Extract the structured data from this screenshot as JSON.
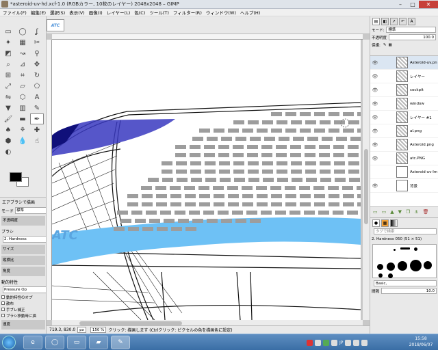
{
  "window": {
    "title": "*asteroid-uv-hd.xcf-1.0 (RGBカラー, 10枚のレイヤー) 2048x2048 – GIMP",
    "minimize": "–",
    "maximize": "□",
    "close": "✕"
  },
  "menu": [
    "ファイル(F)",
    "編集(E)",
    "選択(S)",
    "表示(V)",
    "画像(I)",
    "レイヤー(L)",
    "色(C)",
    "ツール(T)",
    "フィルター(R)",
    "ウィンドウ(W)",
    "ヘルプ(H)"
  ],
  "tools": [
    "rect-select-icon",
    "ellipse-select-icon",
    "lasso-icon",
    "fuzzy-select-icon",
    "color-select-icon",
    "scissors-icon",
    "foreground-select-icon",
    "paths-icon",
    "color-picker-icon",
    "zoom-icon",
    "measure-icon",
    "move-icon",
    "align-icon",
    "crop-icon",
    "rotate-icon",
    "scale-icon",
    "shear-icon",
    "perspective-icon",
    "flip-icon",
    "cage-icon",
    "text-icon",
    "bucket-fill-icon",
    "blend-icon",
    "pencil-icon",
    "paintbrush-icon",
    "eraser-icon",
    "airbrush-icon",
    "ink-icon",
    "clone-icon",
    "heal-icon",
    "perspective-clone-icon",
    "blur-icon",
    "smudge-icon",
    "dodge-burn-icon"
  ],
  "tool_options": {
    "title": "エアブラシで描画",
    "mode_label": "モード",
    "mode_value": "標準",
    "opacity_label": "不透明度",
    "brush_label": "ブラシ",
    "brush_value": "2. Hardness",
    "size_label": "サイズ",
    "aspect_label": "縦横比",
    "angle_label": "角度",
    "dynamics_label": "動的特性",
    "dynamics_value": "Pressure Op",
    "dynamics_options": "動的特性のオプ",
    "checks": [
      "散布",
      "手ブレ補正",
      "ブラシ移動時に描"
    ],
    "rate_label": "速度"
  },
  "image_tab_thumb": "ATC",
  "canvas": {
    "logo_text": "ATC",
    "colors": {
      "stripe": "#6ec1f5",
      "window": "#2a2ac8",
      "dots": "#9d9d9d"
    }
  },
  "statusbar": {
    "coords": "719.3, 830.0",
    "unit": "px",
    "zoom": "150 %",
    "message": "クリック: 描画します (Ctrlクリック: ピクセルの色を描画色に設定)"
  },
  "dock": {
    "mode_label": "モード:",
    "mode_value": "標準",
    "opacity_label": "不透明度",
    "opacity_value": "100.0",
    "lock_label": "保護:",
    "layers": [
      {
        "name": "Asteroid-uv.pn",
        "thumb": "checker",
        "visible": true,
        "selected": true
      },
      {
        "name": "レイヤー",
        "thumb": "checker",
        "visible": true,
        "selected": false
      },
      {
        "name": "cockpit",
        "thumb": "checker",
        "visible": true,
        "selected": false
      },
      {
        "name": "window",
        "thumb": "checker",
        "visible": true,
        "selected": false
      },
      {
        "name": "レイヤー #1",
        "thumb": "checker",
        "visible": true,
        "selected": false
      },
      {
        "name": "al.png",
        "thumb": "checker",
        "visible": true,
        "selected": false
      },
      {
        "name": "Asteroid.png",
        "thumb": "checker",
        "visible": true,
        "selected": false
      },
      {
        "name": "atc.PNG",
        "thumb": "checker",
        "visible": true,
        "selected": false
      },
      {
        "name": "Asteroid-uv-lm",
        "thumb": "white",
        "visible": false,
        "selected": false
      },
      {
        "name": "背景",
        "thumb": "white",
        "visible": true,
        "selected": false
      }
    ],
    "brush_filter_placeholder": "タグで検索",
    "brush_name": "2. Hardness 050 (51 × 51)",
    "brush_set": "Basic,",
    "spacing_label": "間隔",
    "spacing_value": "10.0"
  },
  "taskbar": {
    "tray_lang": "JP",
    "time": "15:58",
    "date": "2018/06/07"
  }
}
